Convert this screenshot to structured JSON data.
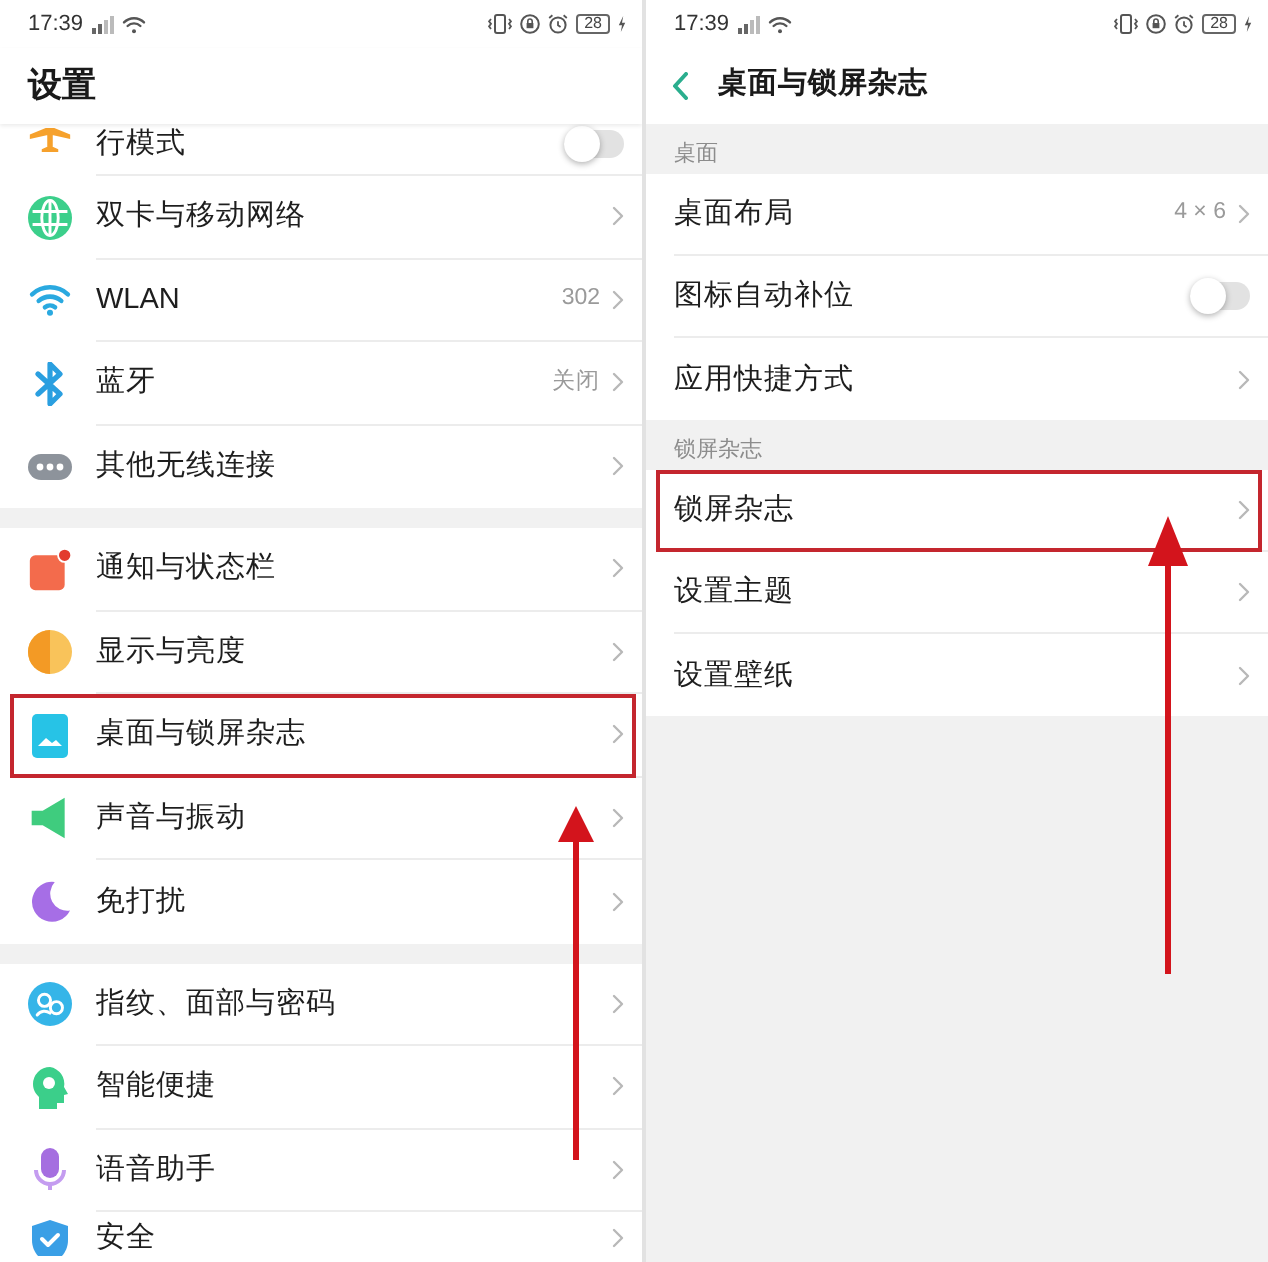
{
  "screens": [
    {
      "status_bar": {
        "time": "17:39",
        "battery": "28"
      },
      "header": {
        "kind": "title",
        "title": "设置"
      },
      "sections": [
        {
          "rows": [
            {
              "label": "行模式",
              "kind": "toggle",
              "on": false,
              "highlighted": false
            },
            {
              "label": "双卡与移动网络",
              "kind": "link",
              "highlighted": false
            },
            {
              "label": "WLAN",
              "kind": "link",
              "value": "302",
              "highlighted": false
            },
            {
              "label": "蓝牙",
              "kind": "link",
              "value": "关闭",
              "highlighted": false
            },
            {
              "label": "其他无线连接",
              "kind": "link",
              "highlighted": false
            }
          ]
        },
        {
          "rows": [
            {
              "label": "通知与状态栏",
              "kind": "link",
              "highlighted": false
            },
            {
              "label": "显示与亮度",
              "kind": "link",
              "highlighted": false
            },
            {
              "label": "桌面与锁屏杂志",
              "kind": "link",
              "highlighted": true
            },
            {
              "label": "声音与振动",
              "kind": "link",
              "highlighted": false
            },
            {
              "label": "免打扰",
              "kind": "link",
              "highlighted": false
            }
          ]
        },
        {
          "rows": [
            {
              "label": "指纹、面部与密码",
              "kind": "link",
              "highlighted": false
            },
            {
              "label": "智能便捷",
              "kind": "link",
              "highlighted": false
            },
            {
              "label": "语音助手",
              "kind": "link",
              "highlighted": false
            },
            {
              "label": "安全",
              "kind": "link",
              "highlighted": false
            }
          ]
        }
      ]
    },
    {
      "status_bar": {
        "time": "17:39",
        "battery": "28"
      },
      "header": {
        "kind": "back",
        "title": "桌面与锁屏杂志"
      },
      "sections": [
        {
          "title": "桌面",
          "rows": [
            {
              "label": "桌面布局",
              "kind": "link",
              "value": "4 × 6",
              "highlighted": false
            },
            {
              "label": "图标自动补位",
              "kind": "toggle",
              "on": false,
              "highlighted": false
            },
            {
              "label": "应用快捷方式",
              "kind": "link",
              "highlighted": false
            }
          ]
        },
        {
          "title": "锁屏杂志",
          "rows": [
            {
              "label": "锁屏杂志",
              "kind": "link",
              "highlighted": true
            },
            {
              "label": "设置主题",
              "kind": "link",
              "highlighted": false
            },
            {
              "label": "设置壁纸",
              "kind": "link",
              "highlighted": false
            }
          ]
        }
      ]
    }
  ]
}
